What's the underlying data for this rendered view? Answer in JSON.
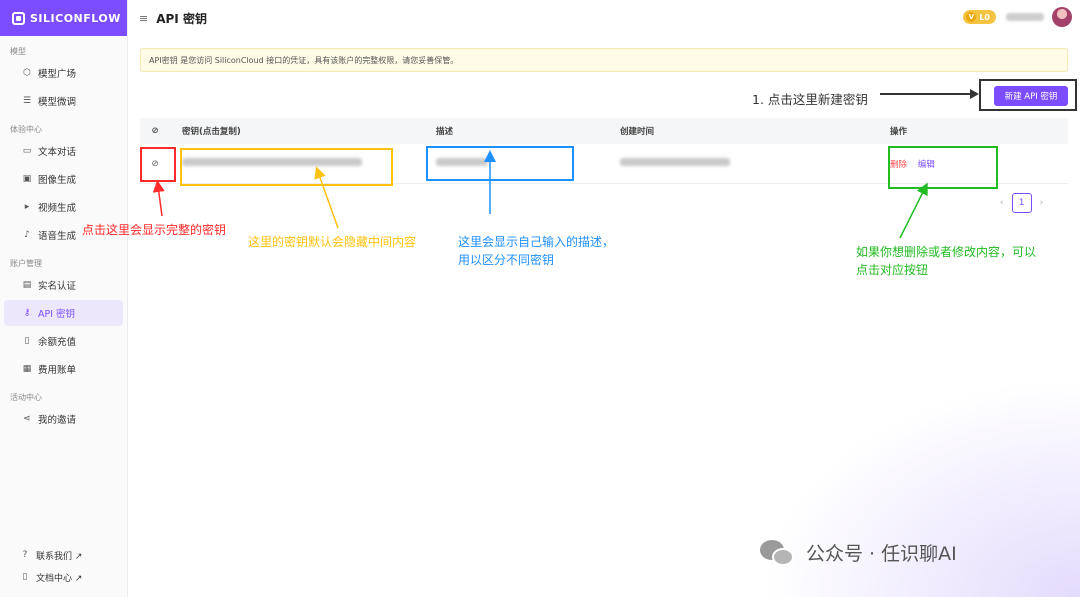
{
  "app": {
    "logo_text": "SILICONFLOW"
  },
  "header": {
    "title": "API 密钥",
    "level": "L0"
  },
  "sidebar": {
    "sections": [
      {
        "label": "模型",
        "items": [
          {
            "label": "模型广场",
            "icon": "cube-icon"
          },
          {
            "label": "模型微调",
            "icon": "sliders-icon"
          }
        ]
      },
      {
        "label": "体验中心",
        "items": [
          {
            "label": "文本对话",
            "icon": "chat-icon"
          },
          {
            "label": "图像生成",
            "icon": "image-icon"
          },
          {
            "label": "视频生成",
            "icon": "video-icon"
          },
          {
            "label": "语音生成",
            "icon": "mic-icon"
          }
        ]
      },
      {
        "label": "账户管理",
        "items": [
          {
            "label": "实名认证",
            "icon": "id-card-icon"
          },
          {
            "label": "API 密钥",
            "icon": "key-icon",
            "active": true
          },
          {
            "label": "余额充值",
            "icon": "wallet-icon"
          },
          {
            "label": "费用账单",
            "icon": "bill-icon"
          }
        ]
      },
      {
        "label": "活动中心",
        "items": [
          {
            "label": "我的邀请",
            "icon": "share-icon"
          }
        ]
      }
    ],
    "bottom": [
      {
        "label": "联系我们 ↗",
        "icon": "help-icon"
      },
      {
        "label": "文档中心 ↗",
        "icon": "doc-icon"
      }
    ]
  },
  "notice": "API密钥 是您访问 SiliconCloud 接口的凭证，具有该账户的完整权限，请您妥善保管。",
  "new_key_button": "新建 API 密钥",
  "table": {
    "headers": {
      "key": "密钥(点击复制)",
      "desc": "描述",
      "created": "创建时间",
      "actions": "操作"
    },
    "row": {
      "delete": "删除",
      "edit": "编辑"
    }
  },
  "pagination": {
    "current": "1",
    "prev": "‹",
    "next": "›"
  },
  "annotations": {
    "step1": "1. 点击这里新建密钥",
    "eye": "点击这里会显示完整的密钥",
    "key": "这里的密钥默认会隐藏中间内容",
    "desc_line1": "这里会显示自己输入的描述，",
    "desc_line2": "用以区分不同密钥",
    "actions_line1": "如果你想删除或者修改内容，可以",
    "actions_line2": "点击对应按钮"
  },
  "colors": {
    "accent": "#7c4dff",
    "red": "#ff2a2a",
    "yellow": "#ffc20e",
    "blue": "#1e90ff",
    "green": "#22bb22"
  },
  "watermark": {
    "text": "公众号 · 任识聊AI"
  }
}
